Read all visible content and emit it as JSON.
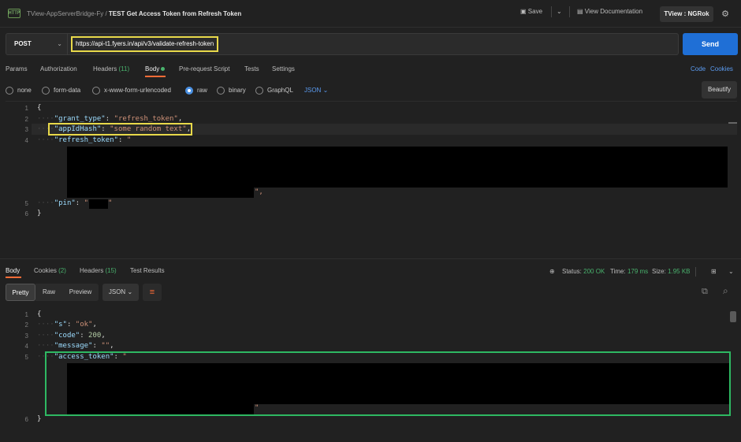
{
  "header": {
    "collection": "TView-AppServerBridge-Fy",
    "separator": "/",
    "request_name": "TEST Get Access Token from Refresh Token",
    "request_icon_text": "HTTP",
    "save_label": "Save",
    "view_docs_label": "View Documentation",
    "environment": "TView : NGRok"
  },
  "request": {
    "method": "POST",
    "url": "https://api-t1.fyers.in/api/v3/validate-refresh-token",
    "send_label": "Send"
  },
  "tabs": [
    {
      "label": "Params"
    },
    {
      "label": "Authorization"
    },
    {
      "label": "Headers",
      "count": "(11)"
    },
    {
      "label": "Body"
    },
    {
      "label": "Pre-request Script"
    },
    {
      "label": "Tests"
    },
    {
      "label": "Settings"
    }
  ],
  "links": {
    "code": "Code",
    "cookies": "Cookies"
  },
  "body_types": [
    "none",
    "form-data",
    "x-www-form-urlencoded",
    "raw",
    "binary",
    "GraphQL"
  ],
  "body_type_selected": "raw",
  "format": "JSON",
  "beautify_label": "Beautify",
  "request_body": {
    "line_numbers": [
      "1",
      "2",
      "3",
      "4",
      "5",
      "6"
    ],
    "open": "{",
    "grant_type_key": "\"grant_type\"",
    "grant_type_val": "\"refresh_token\"",
    "appid_key": "\"appIdHash\"",
    "appid_val": "\"some random text\"",
    "refresh_key": "\"refresh_token\"",
    "refresh_open": "\"",
    "refresh_close": "\",",
    "pin_key": "\"pin\"",
    "pin_open": "\"",
    "pin_close": "\"",
    "close": "}"
  },
  "response": {
    "tabs": [
      {
        "label": "Body"
      },
      {
        "label": "Cookies",
        "count": "(2)"
      },
      {
        "label": "Headers",
        "count": "(15)"
      },
      {
        "label": "Test Results"
      }
    ],
    "status_label": "Status:",
    "status_value": "200 OK",
    "time_label": "Time:",
    "time_value": "179 ms",
    "size_label": "Size:",
    "size_value": "1.95 KB",
    "views": [
      "Pretty",
      "Raw",
      "Preview"
    ],
    "view_selected": "Pretty",
    "format": "JSON",
    "line_numbers": [
      "1",
      "2",
      "3",
      "4",
      "5",
      "6"
    ],
    "open": "{",
    "s_key": "\"s\"",
    "s_val": "\"ok\"",
    "code_key": "\"code\"",
    "code_val": "200",
    "message_key": "\"message\"",
    "message_val": "\"\"",
    "token_key": "\"access_token\"",
    "token_open": "\"",
    "token_close": "\"",
    "close": "}"
  },
  "colors": {
    "accent": "#ff6c37",
    "send": "#1f6fd6",
    "highlight_yellow": "#e8d94a",
    "highlight_green": "#2eb862",
    "status_ok": "#49b26d"
  }
}
